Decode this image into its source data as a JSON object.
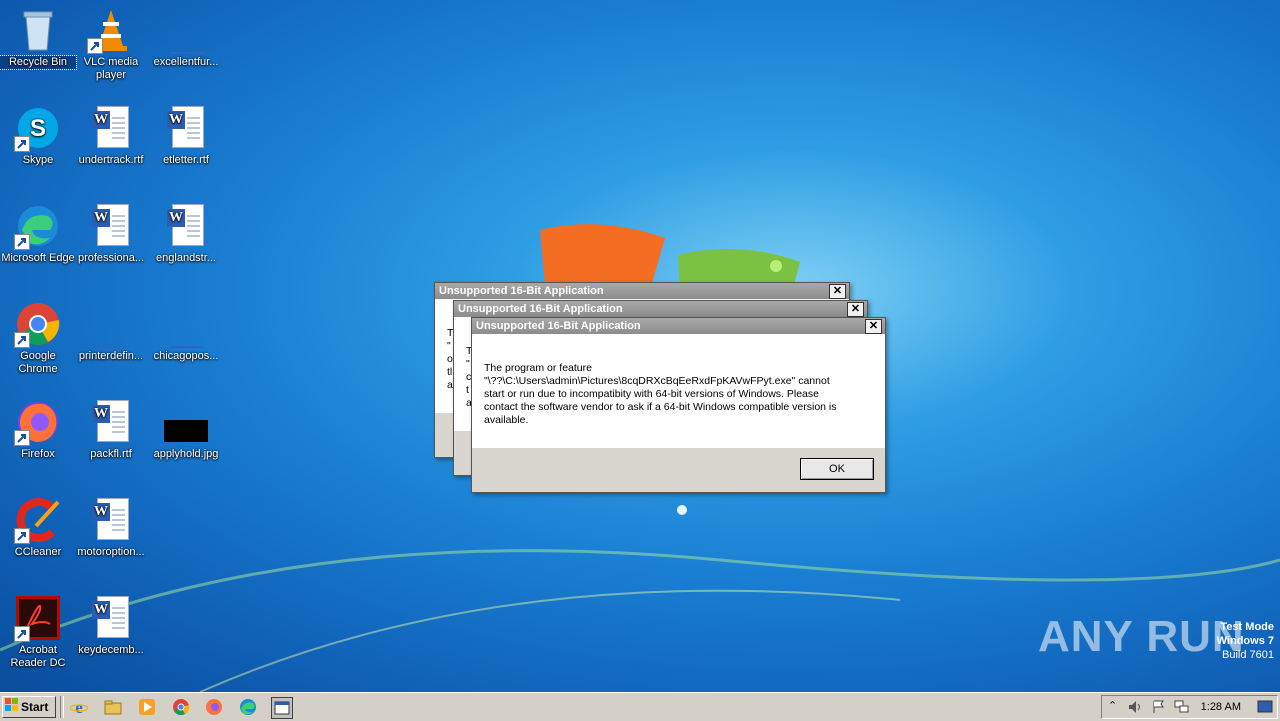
{
  "desktop": {
    "icons": [
      {
        "label": "Recycle Bin"
      },
      {
        "label": "VLC media player"
      },
      {
        "label": "excellentfur..."
      },
      {
        "label": "Skype"
      },
      {
        "label": "undertrack.rtf"
      },
      {
        "label": "etletter.rtf"
      },
      {
        "label": "Microsoft Edge"
      },
      {
        "label": "professiona..."
      },
      {
        "label": "englandstr..."
      },
      {
        "label": "Google Chrome"
      },
      {
        "label": "printerdefin..."
      },
      {
        "label": "chicagopos..."
      },
      {
        "label": "Firefox"
      },
      {
        "label": "packfl.rtf"
      },
      {
        "label": "applyhold.jpg"
      },
      {
        "label": "CCleaner"
      },
      {
        "label": "motoroption..."
      },
      {
        "label": "Acrobat Reader DC"
      },
      {
        "label": "keydecemb..."
      }
    ]
  },
  "dialogs": {
    "back": {
      "title": "Unsupported 16-Bit Application",
      "lines": [
        "T",
        "\"",
        "o",
        "tl",
        "a"
      ]
    },
    "middle": {
      "title": "Unsupported 16-Bit Application",
      "lines": [
        "T",
        "\"",
        "c",
        "t",
        "a"
      ]
    },
    "front": {
      "title": "Unsupported 16-Bit Application",
      "close": "✕",
      "message_lines": [
        "The program or feature",
        "\"\\??\\C:\\Users\\admin\\Pictures\\8cqDRXcBqEeRxdFpKAVwFPyt.exe\" cannot",
        "start or run due to incompatibity with 64-bit versions of Windows. Please",
        "contact the software vendor to ask if a 64-bit Windows compatible version is",
        "available."
      ],
      "ok_label": "OK"
    }
  },
  "watermark": {
    "brand": "ANY RUN",
    "line1": "Test Mode",
    "line2": "Windows 7",
    "line3": "Build 7601"
  },
  "taskbar": {
    "start_label": "Start",
    "clock": "1:28 AM",
    "tray_icons": [
      "chevron-up-icon",
      "speaker-icon",
      "flag-icon",
      "network-icon"
    ],
    "pinned": [
      "internet-explorer-icon",
      "file-explorer-icon",
      "media-player-icon",
      "chrome-icon",
      "firefox-icon",
      "edge-icon",
      "app-window-icon"
    ]
  }
}
